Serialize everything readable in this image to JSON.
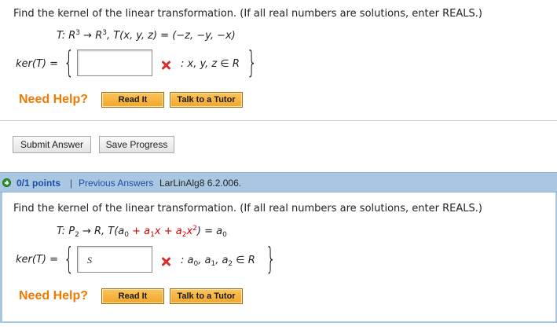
{
  "q1": {
    "prompt": "Find the kernel of the linear transformation. (If all real numbers are solutions, enter REALS.)",
    "transformation": {
      "map": "T: R",
      "domain_exp": "3",
      "arrow": " → R",
      "codomain_exp": "3",
      "rule": ", T(x, y, z) = (−z, −y, −x)"
    },
    "kernel_label": "ker(T) =",
    "input_value": "",
    "set_condition": ": x, y, z ∈ R",
    "need_help": "Need Help?",
    "read_it": "Read It",
    "talk_to_tutor": "Talk to a Tutor",
    "submit_answer": "Submit Answer",
    "save_progress": "Save Progress"
  },
  "q2": {
    "points": "0/1 points",
    "separator": "|",
    "previous_answers": "Previous Answers",
    "problem_id": "LarLinAlg8 6.2.006.",
    "prompt": "Find the kernel of the linear transformation. (If all real numbers are solutions, enter REALS.)",
    "transformation": {
      "map": "T: P",
      "domain_sub": "2",
      "arrow": " → R, T(a",
      "a0_sub": "0",
      "plus1": " + a",
      "a1_sub": "1",
      "x1": "x + a",
      "a2_sub": "2",
      "x2": "x",
      "x2_exp": "2",
      "close": ") = a",
      "result_sub": "0"
    },
    "kernel_label": "ker(T) =",
    "input_value": "S",
    "set_condition_a": ": a",
    "set_sub0": "0",
    "set_condition_b": ", a",
    "set_sub1": "1",
    "set_condition_c": ", a",
    "set_sub2": "2",
    "set_condition_d": " ∈ R",
    "need_help": "Need Help?",
    "read_it": "Read It",
    "talk_to_tutor": "Talk to a Tutor"
  },
  "icons": {
    "incorrect": "x-mark-icon",
    "expand": "plus-circle-icon"
  },
  "colors": {
    "need_help": "#f07a00",
    "incorrect_mark": "#d9302c",
    "header_bar": "#aac7e2",
    "link": "#1a4fa8",
    "input_highlight": "#d40000"
  }
}
